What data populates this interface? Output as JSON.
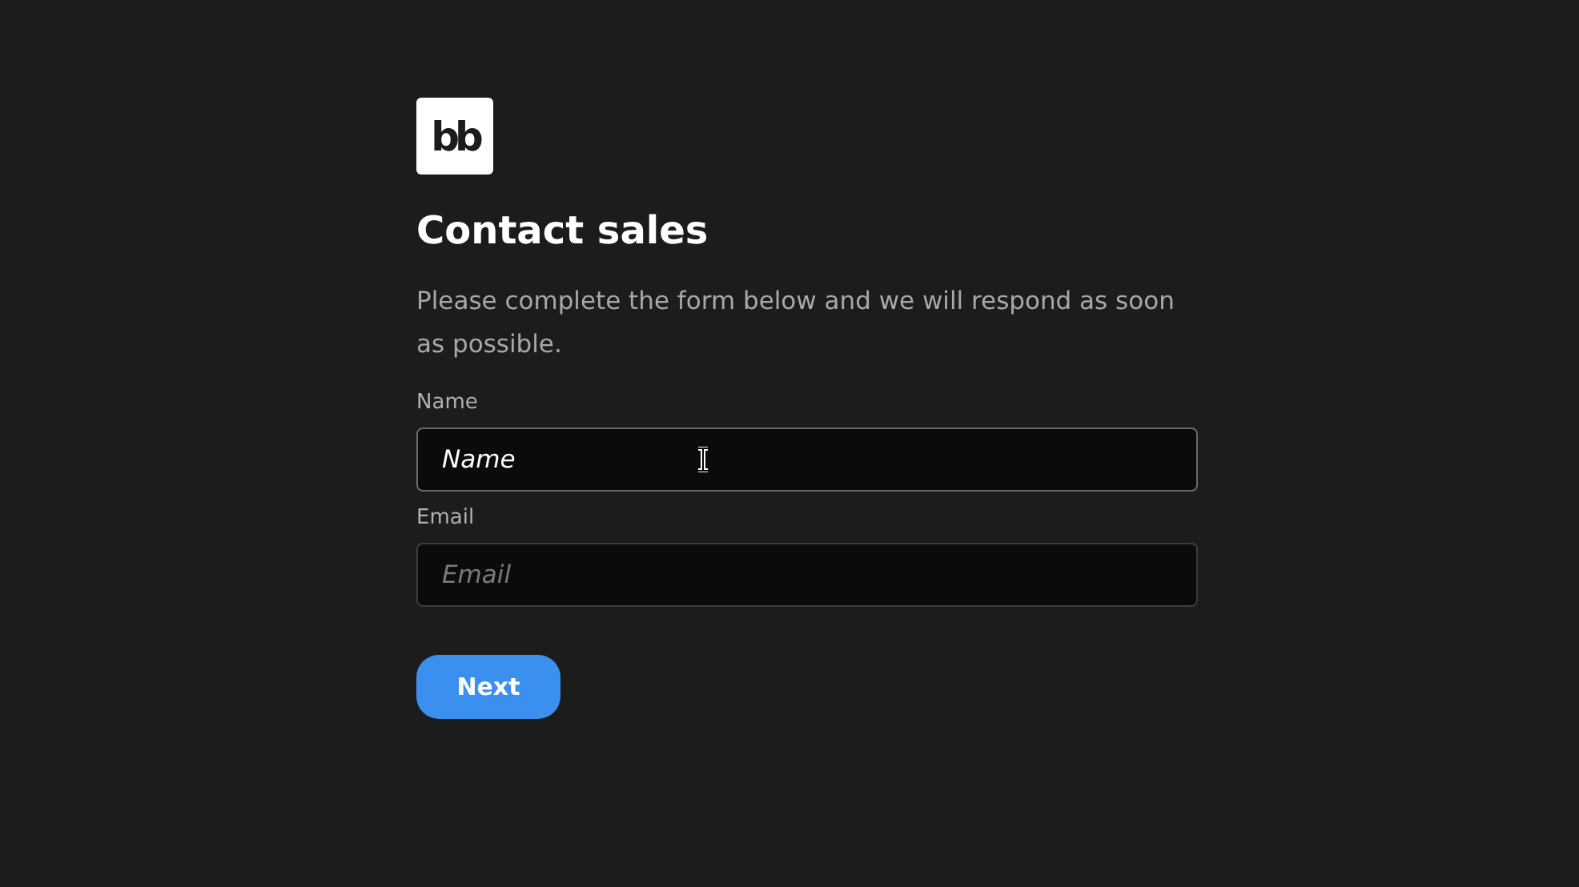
{
  "logo": {
    "text": "bb"
  },
  "title": "Contact sales",
  "description": "Please complete the form below and we will respond as soon as possible.",
  "fields": [
    {
      "label": "Name",
      "placeholder": "Name",
      "focused": true
    },
    {
      "label": "Email",
      "placeholder": "Email",
      "focused": false
    }
  ],
  "buttons": [
    "Next"
  ]
}
